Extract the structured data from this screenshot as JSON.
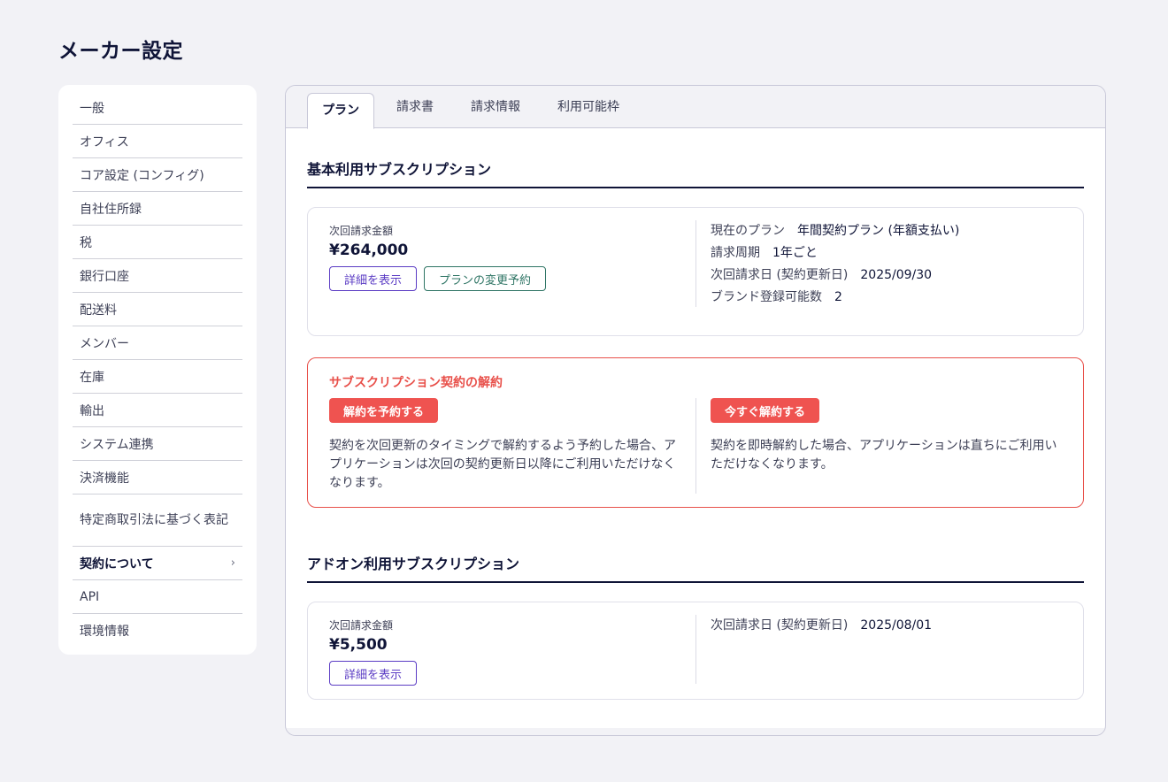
{
  "page_title": "メーカー設定",
  "sidebar": {
    "items": [
      {
        "label": "一般"
      },
      {
        "label": "オフィス"
      },
      {
        "label": "コア設定 (コンフィグ)"
      },
      {
        "label": "自社住所録"
      },
      {
        "label": "税"
      },
      {
        "label": "銀行口座"
      },
      {
        "label": "配送料"
      },
      {
        "label": "メンバー"
      },
      {
        "label": "在庫"
      },
      {
        "label": "輸出"
      },
      {
        "label": "システム連携"
      },
      {
        "label": "決済機能"
      },
      {
        "label": "特定商取引法に基づく表記"
      },
      {
        "label": "契約について"
      },
      {
        "label": "API"
      },
      {
        "label": "環境情報"
      }
    ],
    "active_chevron": "›"
  },
  "tabs": [
    {
      "label": "プラン"
    },
    {
      "label": "請求書"
    },
    {
      "label": "請求情報"
    },
    {
      "label": "利用可能枠"
    }
  ],
  "basic": {
    "heading": "基本利用サブスクリプション",
    "next_amount_label": "次回請求金額",
    "next_amount": "¥264,000",
    "details_button": "詳細を表示",
    "change_plan_button": "プランの変更予約",
    "info": [
      {
        "label": "現在のプラン",
        "value": "年間契約プラン (年額支払い)"
      },
      {
        "label": "請求周期",
        "value": "1年ごと"
      },
      {
        "label": "次回請求日 (契約更新日)",
        "value": "2025/09/30"
      },
      {
        "label": "ブランド登録可能数",
        "value": "2"
      }
    ]
  },
  "cancel": {
    "title": "サブスクリプション契約の解約",
    "reserve_button": "解約を予約する",
    "reserve_text": "契約を次回更新のタイミングで解約するよう予約した場合、アプリケーションは次回の契約更新日以降にご利用いただけなくなります。",
    "immediate_button": "今すぐ解約する",
    "immediate_text": "契約を即時解約した場合、アプリケーションは直ちにご利用いただけなくなります。"
  },
  "addon": {
    "heading": "アドオン利用サブスクリプション",
    "next_amount_label": "次回請求金額",
    "next_amount": "¥5,500",
    "details_button": "詳細を表示",
    "info": [
      {
        "label": "次回請求日 (契約更新日)",
        "value": "2025/08/01"
      }
    ]
  },
  "colors": {
    "accent_purple": "#5b3cc4",
    "accent_teal": "#2f7565",
    "danger_red": "#ef5350",
    "heading_navy": "#0f1437"
  }
}
